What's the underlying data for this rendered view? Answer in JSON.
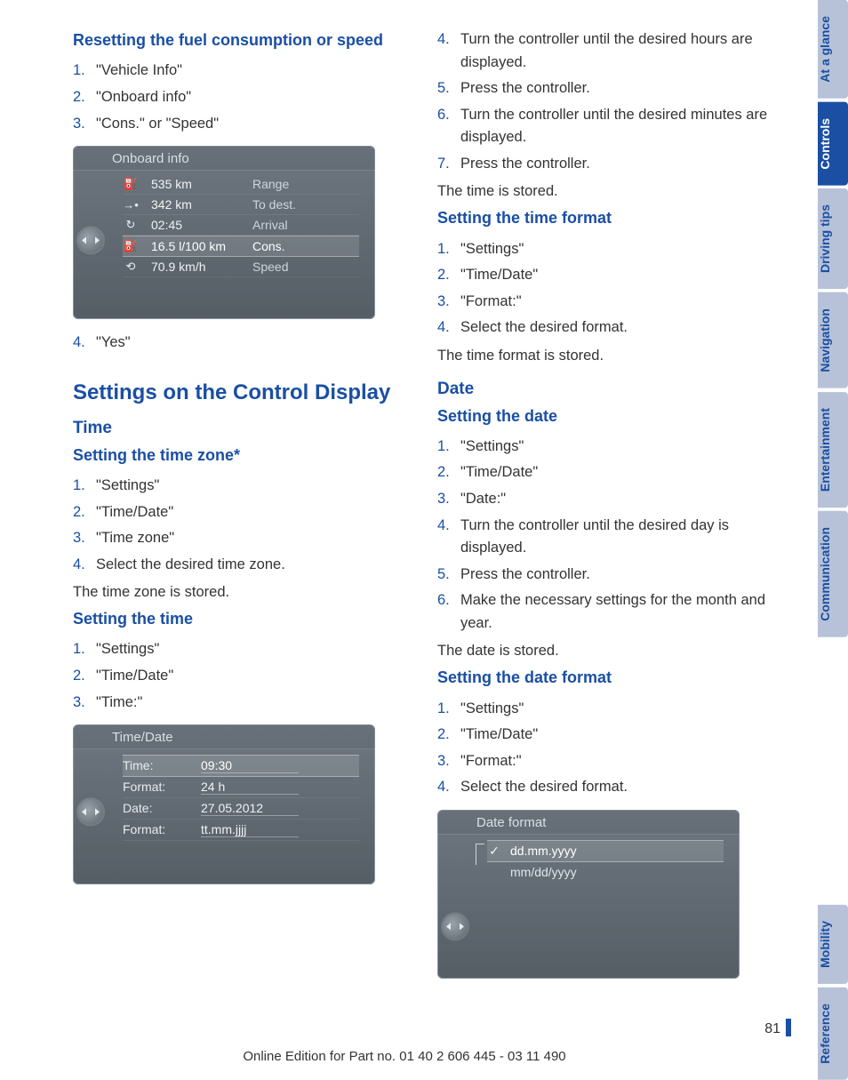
{
  "left": {
    "h3_reset": "Resetting the fuel consumption or speed",
    "reset_steps": [
      "\"Vehicle Info\"",
      "\"Onboard info\"",
      "\"Cons.\" or \"Speed\""
    ],
    "screen1": {
      "title": "Onboard info",
      "rows": [
        {
          "icon": "⛽",
          "v1": "535 km",
          "v2": "Range"
        },
        {
          "icon": "→•",
          "v1": "342 km",
          "v2": "To dest."
        },
        {
          "icon": "↻",
          "v1": "02:45",
          "v2": "Arrival"
        },
        {
          "icon": "⛽",
          "v1": "16.5 l/100 km",
          "v2": "Cons.",
          "hl": true
        },
        {
          "icon": "⟲",
          "v1": "70.9 km/h",
          "v2": "Speed"
        }
      ]
    },
    "reset_step4": "\"Yes\"",
    "h1": "Settings on the Control Display",
    "h2_time": "Time",
    "h3_tz": "Setting the time zone*",
    "tz_steps": [
      "\"Settings\"",
      "\"Time/Date\"",
      "\"Time zone\"",
      "Select the desired time zone."
    ],
    "tz_note": "The time zone is stored.",
    "h3_time": "Setting the time",
    "time_steps": [
      "\"Settings\"",
      "\"Time/Date\"",
      "\"Time:\""
    ],
    "screen2": {
      "title": "Time/Date",
      "rows": [
        {
          "k": "Time:",
          "v": "09:30",
          "hl": true
        },
        {
          "k": "Format:",
          "v": "24 h"
        },
        {
          "k": "Date:",
          "v": "27.05.2012"
        },
        {
          "k": "Format:",
          "v": "tt.mm.jjjj"
        }
      ]
    }
  },
  "right": {
    "cont_steps": [
      {
        "n": "4.",
        "t": "Turn the controller until the desired hours are displayed."
      },
      {
        "n": "5.",
        "t": "Press the controller."
      },
      {
        "n": "6.",
        "t": "Turn the controller until the desired minutes are displayed."
      },
      {
        "n": "7.",
        "t": "Press the controller."
      }
    ],
    "cont_note": "The time is stored.",
    "h3_tfmt": "Setting the time format",
    "tfmt_steps": [
      "\"Settings\"",
      "\"Time/Date\"",
      "\"Format:\"",
      "Select the desired format."
    ],
    "tfmt_note": "The time format is stored.",
    "h2_date": "Date",
    "h3_date": "Setting the date",
    "date_steps": [
      "\"Settings\"",
      "\"Time/Date\"",
      "\"Date:\"",
      "Turn the controller until the desired day is displayed.",
      "Press the controller.",
      "Make the necessary settings for the month and year."
    ],
    "date_note": "The date is stored.",
    "h3_dfmt": "Setting the date format",
    "dfmt_steps": [
      "\"Settings\"",
      "\"Time/Date\"",
      "\"Format:\"",
      "Select the desired format."
    ],
    "screen3": {
      "title": "Date format",
      "opts": [
        {
          "chk": "✓",
          "t": "dd.mm.yyyy",
          "hl": true
        },
        {
          "chk": "",
          "t": "mm/dd/yyyy"
        }
      ]
    }
  },
  "tabs": [
    "At a glance",
    "Controls",
    "Driving tips",
    "Navigation",
    "Entertainment",
    "Communication",
    "Mobility",
    "Reference"
  ],
  "active_tab_index": 1,
  "page_number": "81",
  "footer": "Online Edition for Part no. 01 40 2 606 445 - 03 11 490"
}
